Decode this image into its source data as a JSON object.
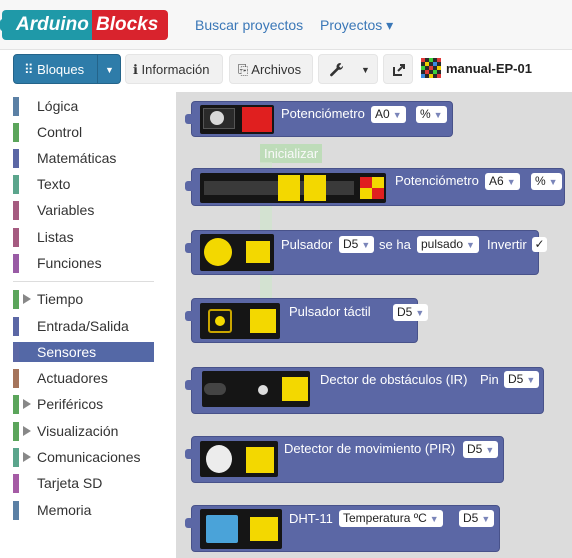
{
  "nav": {
    "logo_left": "Arduino",
    "logo_right": "Blocks",
    "search_projects": "Buscar proyectos",
    "projects_menu": "Proyectos ▾"
  },
  "toolbar": {
    "blocks": "⠿ Bloques",
    "blocks_caret": "▼",
    "info": "ℹ Información",
    "files": "⎘ Archivos",
    "tools_caret": "▼",
    "project_name": "manual-EP-01"
  },
  "sidebar": {
    "items": [
      {
        "label": "Lógica",
        "color": "#5b80a5"
      },
      {
        "label": "Control",
        "color": "#5ba55b"
      },
      {
        "label": "Matemáticas",
        "color": "#5b67a5"
      },
      {
        "label": "Texto",
        "color": "#5ba58c"
      },
      {
        "label": "Variables",
        "color": "#a55b80"
      },
      {
        "label": "Listas",
        "color": "#a55b80"
      },
      {
        "label": "Funciones",
        "color": "#995ba5"
      },
      {
        "label": "Tiempo",
        "color": "#5ba55b"
      },
      {
        "label": "Entrada/Salida",
        "color": "#5b67a5"
      },
      {
        "label": "Sensores",
        "color": "#5b67a5"
      },
      {
        "label": "Actuadores",
        "color": "#a5745b"
      },
      {
        "label": "Periféricos",
        "color": "#5ba55b"
      },
      {
        "label": "Visualización",
        "color": "#5ba55b"
      },
      {
        "label": "Comunicaciones",
        "color": "#5ba58c"
      },
      {
        "label": "Tarjeta SD",
        "color": "#a55ba5"
      },
      {
        "label": "Memoria",
        "color": "#5b80a5"
      }
    ]
  },
  "workspace": {
    "ghost_label": "Inicializar",
    "blocks": [
      {
        "label": "Potenciómetro",
        "pin": "A0",
        "unit": "%"
      },
      {
        "label": "Potenciómetro",
        "pin": "A6",
        "unit": "%"
      },
      {
        "label": "Pulsador",
        "pin": "D5",
        "mid": "se ha",
        "state": "pulsado",
        "invert": "Invertir",
        "check": "✓"
      },
      {
        "label": "Pulsador táctil",
        "pin": "D5"
      },
      {
        "label": "Dector de obstáculos (IR)",
        "pin_label": "Pin",
        "pin": "D5"
      },
      {
        "label": "Detector de movimiento (PIR)",
        "pin": "D5"
      },
      {
        "label": "DHT-11",
        "measure": "Temperatura ºC",
        "pin": "D5"
      }
    ]
  },
  "colors": {
    "sensor_block": "#5b67a5",
    "toolbar_primary": "#2e7ca9",
    "logo_teal": "#1f99a8",
    "logo_red": "#d9232d"
  }
}
